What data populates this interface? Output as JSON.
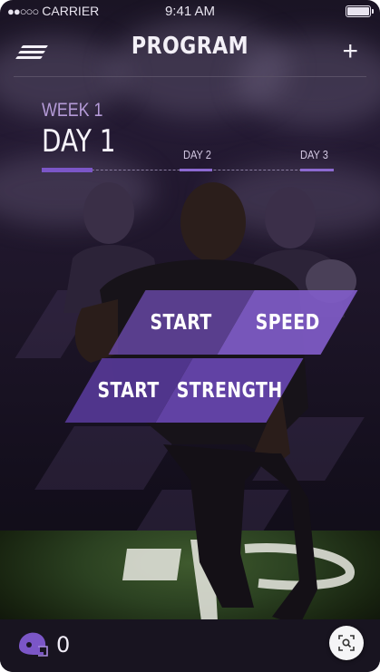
{
  "status_bar": {
    "signal": "●●○○○",
    "carrier": "CARRIER",
    "time": "9:41 AM"
  },
  "header": {
    "title": "PROGRAM"
  },
  "schedule": {
    "week_label": "WEEK 1",
    "current_day": "DAY 1",
    "days": [
      "DAY 2",
      "DAY 3"
    ]
  },
  "tiles": [
    {
      "label": "START"
    },
    {
      "label": "SPEED"
    },
    {
      "label": "START"
    },
    {
      "label": "STRENGTH"
    }
  ],
  "footer": {
    "helmet_count": "0"
  },
  "colors": {
    "accent": "#7b56c7",
    "tile_dark": "#5b3b9c",
    "tile_light": "#7a55c5",
    "background": "#1a1424"
  },
  "icons": [
    "menu-icon",
    "plus-icon",
    "helmet-icon",
    "lens-icon"
  ]
}
